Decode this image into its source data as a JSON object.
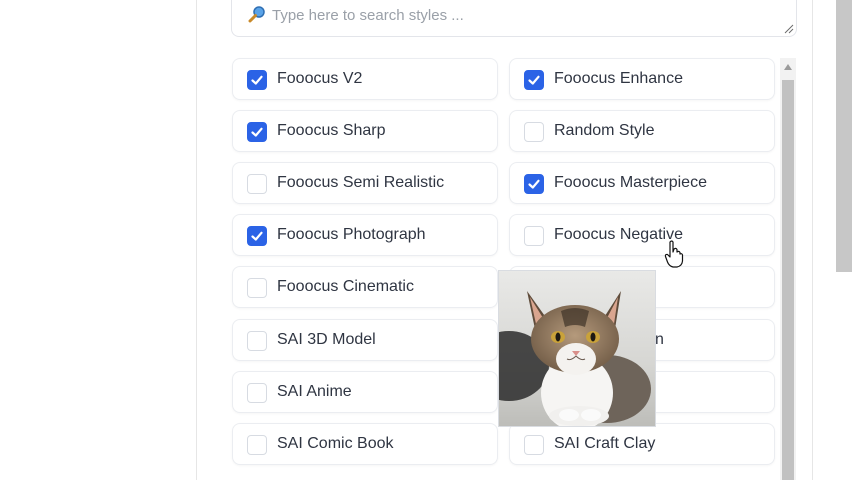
{
  "search": {
    "placeholder": "Type here to search styles ..."
  },
  "styles": [
    {
      "label": "Fooocus V2",
      "checked": true
    },
    {
      "label": "Fooocus Enhance",
      "checked": true
    },
    {
      "label": "Fooocus Sharp",
      "checked": true
    },
    {
      "label": "Random Style",
      "checked": false
    },
    {
      "label": "Fooocus Semi Realistic",
      "checked": false
    },
    {
      "label": "Fooocus Masterpiece",
      "checked": true
    },
    {
      "label": "Fooocus Photograph",
      "checked": true
    },
    {
      "label": "Fooocus Negative",
      "checked": false
    },
    {
      "label": "Fooocus Cinematic",
      "checked": false
    },
    {
      "label": "",
      "checked": false
    },
    {
      "label": "SAI 3D Model",
      "checked": false
    },
    {
      "label": "n",
      "checked": false
    },
    {
      "label": "SAI Anime",
      "checked": false
    },
    {
      "label": "",
      "checked": false
    },
    {
      "label": "SAI Comic Book",
      "checked": false
    },
    {
      "label": "SAI Craft Clay",
      "checked": false
    }
  ],
  "preview": {
    "subject": "tabby-white-cat-photo"
  },
  "colors": {
    "accent": "#2b63e6",
    "text": "#2f3542",
    "border": "#ebedf1"
  }
}
